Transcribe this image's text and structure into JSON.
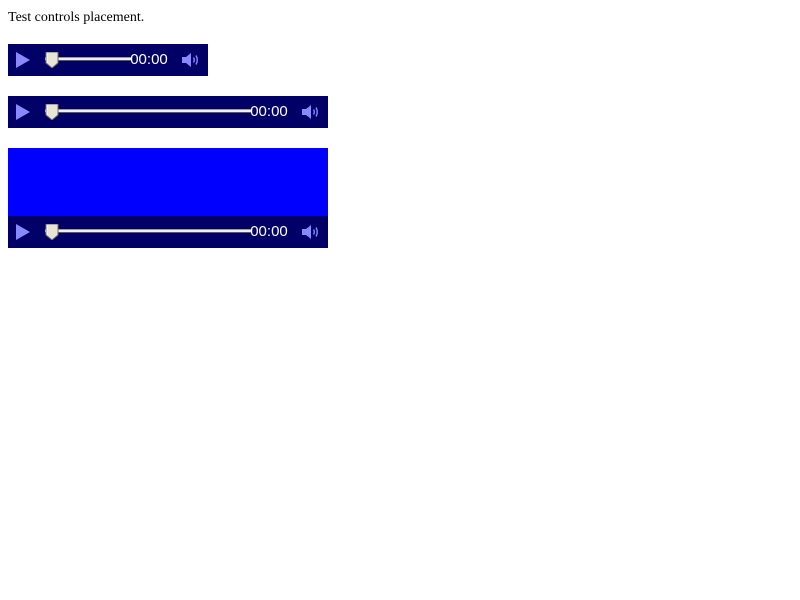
{
  "page": {
    "caption": "Test controls placement."
  },
  "theme": {
    "controls_background": "#000066",
    "video_background": "#0000ff",
    "icon_color": "#8888ff",
    "time_color": "#ffffff",
    "thumb_color": "#e8e4d8"
  },
  "players": [
    {
      "kind": "audio",
      "time": "00:00",
      "progress": 0,
      "icons": [
        "play-icon",
        "scrubber-thumb",
        "volume-icon"
      ]
    },
    {
      "kind": "audio",
      "time": "00:00",
      "progress": 0,
      "icons": [
        "play-icon",
        "scrubber-thumb",
        "volume-icon"
      ]
    },
    {
      "kind": "video",
      "time": "00:00",
      "progress": 0,
      "icons": [
        "play-icon",
        "scrubber-thumb",
        "volume-icon"
      ]
    }
  ]
}
